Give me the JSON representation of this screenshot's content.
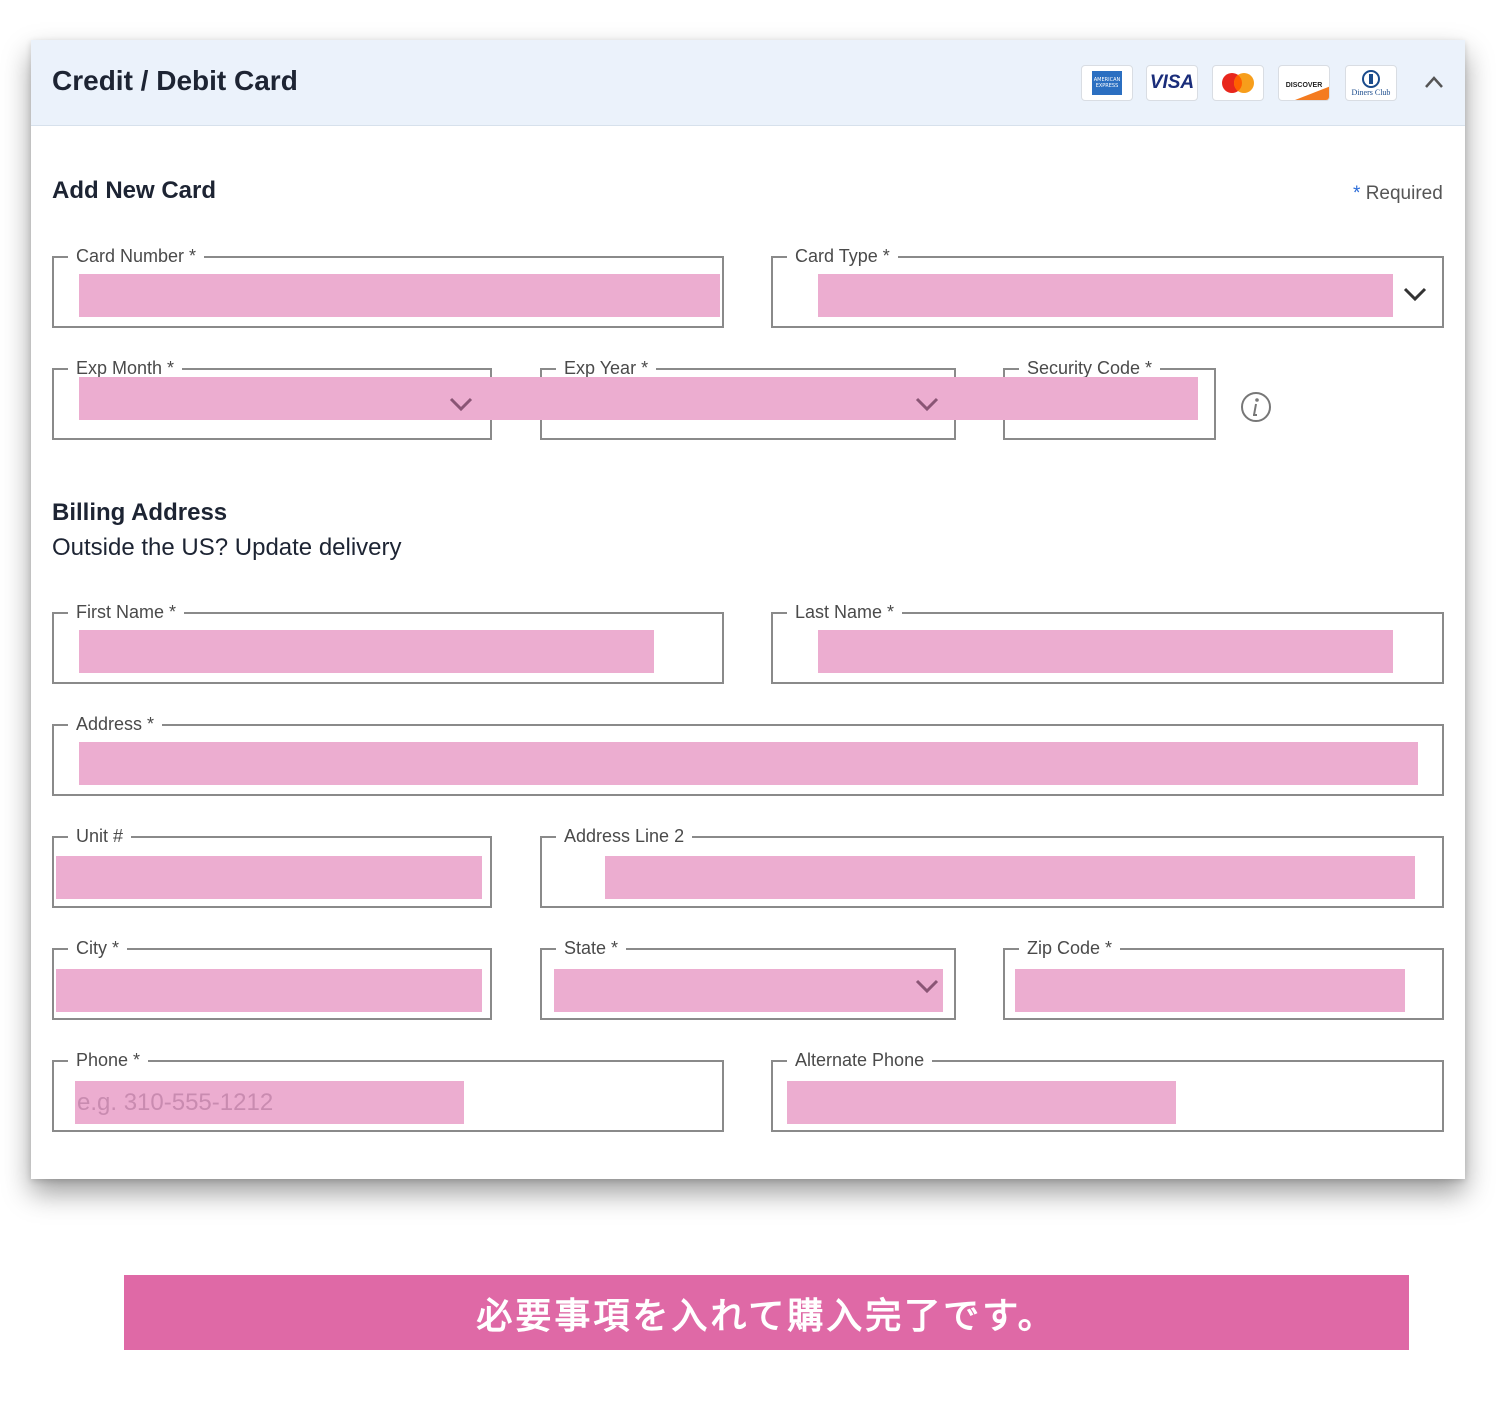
{
  "header": {
    "title": "Credit / Debit Card",
    "card_logos": [
      {
        "name": "amex",
        "label": "AMERICAN EXPRESS"
      },
      {
        "name": "visa",
        "label": "VISA"
      },
      {
        "name": "mastercard",
        "label": ""
      },
      {
        "name": "discover",
        "label": "DISCOVER"
      },
      {
        "name": "diners",
        "label": "Diners Club"
      }
    ]
  },
  "add_card": {
    "title": "Add New Card",
    "required_star": "*",
    "required_label": "Required",
    "fields": {
      "card_number": {
        "label": "Card Number *",
        "value": ""
      },
      "card_type": {
        "label": "Card Type *",
        "value": ""
      },
      "exp_month": {
        "label": "Exp Month *",
        "value": ""
      },
      "exp_year": {
        "label": "Exp Year *",
        "value": ""
      },
      "security_code": {
        "label": "Security Code *",
        "value": ""
      }
    }
  },
  "billing": {
    "title": "Billing Address",
    "subtitle": "Outside the US? Update delivery",
    "fields": {
      "first_name": {
        "label": "First Name *",
        "value": ""
      },
      "last_name": {
        "label": "Last Name *",
        "value": ""
      },
      "address": {
        "label": "Address *",
        "value": ""
      },
      "unit": {
        "label": "Unit #",
        "value": ""
      },
      "address_line2": {
        "label": "Address Line 2",
        "value": ""
      },
      "city": {
        "label": "City *",
        "value": ""
      },
      "state": {
        "label": "State *",
        "value": ""
      },
      "zip": {
        "label": "Zip Code *",
        "value": ""
      },
      "phone": {
        "label": "Phone *",
        "placeholder": "e.g. 310-555-1212",
        "value": ""
      },
      "alt_phone": {
        "label": "Alternate Phone",
        "value": ""
      }
    }
  },
  "banner": {
    "text": "必要事項を入れて購入完了です。"
  },
  "colors": {
    "header_bg": "#ebf2fb",
    "redaction_pink": "#ecadd0",
    "banner_pink": "#df69a6",
    "required_star": "#2a6bd8"
  }
}
